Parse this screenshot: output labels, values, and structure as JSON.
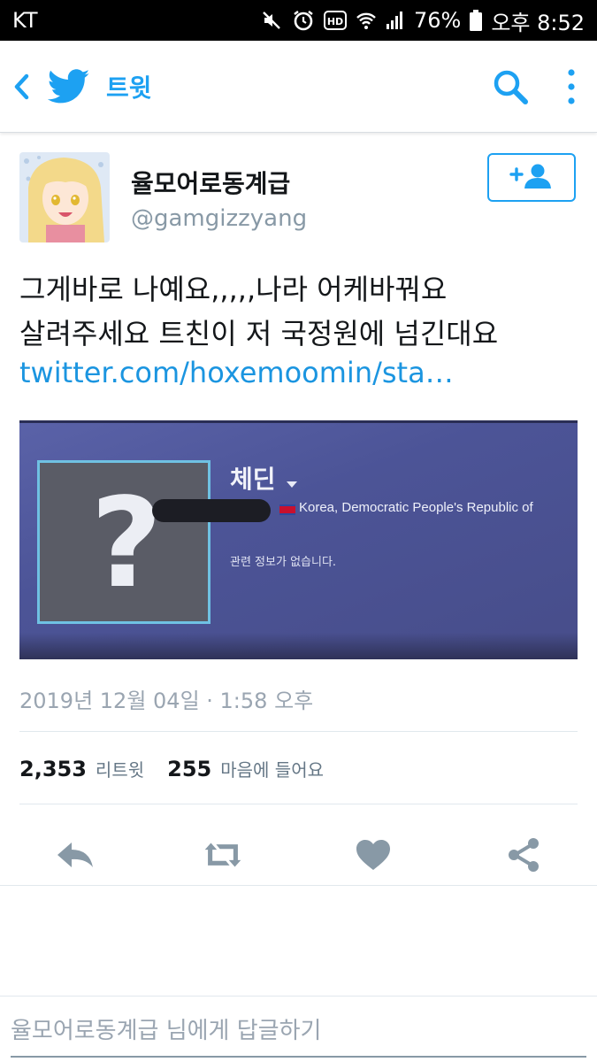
{
  "status_bar": {
    "carrier": "KT",
    "battery": "76%",
    "time": "오후 8:52",
    "icons": [
      "mute-icon",
      "alarm-icon",
      "hd-icon",
      "wifi-icon",
      "signal-icon",
      "battery-icon"
    ]
  },
  "nav": {
    "title": "트윗",
    "icons": [
      "back-icon",
      "twitter-bird-icon",
      "search-icon",
      "more-icon"
    ]
  },
  "colors": {
    "accent": "#1da1f2",
    "link": "#1b95e0",
    "text": "#14171a",
    "muted": "#8899a6"
  },
  "tweet": {
    "display_name": "율모어로동계급",
    "handle": "@gamgizzyang",
    "text_line1": "그게바로 나예요,,,,,나라 어케바꿔요",
    "text_line2": "살려주세요 트친이 저 국정원에 넘긴대요",
    "link": "twitter.com/hoxemoomin/sta…",
    "media": {
      "name": "체딘",
      "country": "Korea, Democratic People's Republic of",
      "no_info": "관련 정보가 없습니다.",
      "placeholder_glyph": "?"
    },
    "timestamp": "2019년 12월 04일 · 1:58 오후",
    "retweets_count": "2,353",
    "retweets_label": "리트윗",
    "likes_count": "255",
    "likes_label": "마음에 들어요"
  },
  "reply": {
    "placeholder": "율모어로동계급 님에게 답글하기"
  }
}
